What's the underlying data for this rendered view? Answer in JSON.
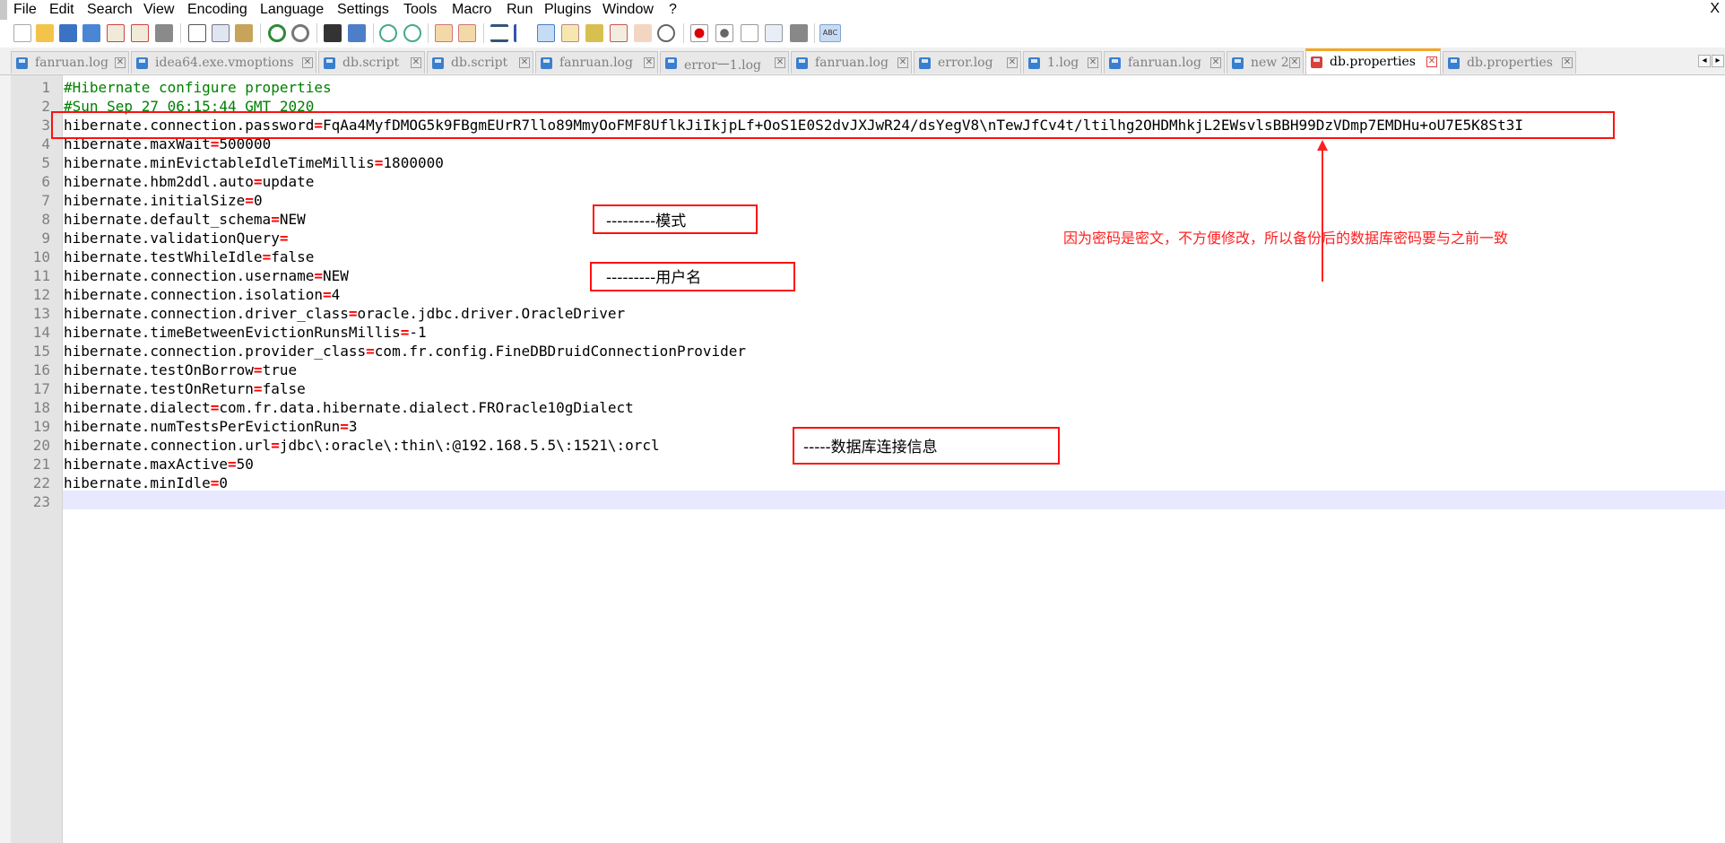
{
  "menu": [
    "File",
    "Edit",
    "Search",
    "View",
    "Encoding",
    "Language",
    "Settings",
    "Tools",
    "Macro",
    "Run",
    "Plugins",
    "Window",
    "?"
  ],
  "window_close": "X",
  "toolbar_icons": [
    "new-file-icon",
    "open-file-icon",
    "save-icon",
    "save-all-icon",
    "close-icon",
    "close-all-icon",
    "print-icon",
    "cut-icon",
    "copy-icon",
    "paste-icon",
    "undo-icon",
    "redo-icon",
    "find-icon",
    "replace-icon",
    "zoom-in-icon",
    "zoom-out-icon",
    "sync-vertical-icon",
    "sync-horizontal-icon",
    "word-wrap-icon",
    "show-all-chars-icon",
    "indent-guide-icon",
    "language-icon",
    "function-list-icon",
    "folder-workspace-icon",
    "monitoring-icon",
    "record-macro-icon",
    "stop-macro-icon",
    "play-macro-icon",
    "run-macro-multiple-icon",
    "save-macro-icon",
    "spell-check-icon"
  ],
  "tabs": [
    {
      "label": "fanruan.log",
      "active": false
    },
    {
      "label": "idea64.exe.vmoptions",
      "active": false
    },
    {
      "label": "db.script",
      "active": false
    },
    {
      "label": "db.script",
      "active": false
    },
    {
      "label": "fanruan.log",
      "active": false
    },
    {
      "label": "error一1.log",
      "active": false
    },
    {
      "label": "fanruan.log",
      "active": false
    },
    {
      "label": "error.log",
      "active": false
    },
    {
      "label": "1.log",
      "active": false
    },
    {
      "label": "fanruan.log",
      "active": false
    },
    {
      "label": "new 2",
      "active": false
    },
    {
      "label": "db.properties",
      "active": true
    },
    {
      "label": "db.properties",
      "active": false
    }
  ],
  "tab_scroll": {
    "left": "◂",
    "right": "▸"
  },
  "lines": [
    {
      "n": "1",
      "comment": "#Hibernate configure properties"
    },
    {
      "n": "2",
      "comment": "#Sun Sep 27 06:15:44 GMT 2020"
    },
    {
      "n": "3",
      "key": "hibernate.connection.password",
      "value": "FqAa4MyfDMOG5k9FBgmEUrR7llo89MmyOoFMF8UflkJiIkjpLf+OoS1E0S2dvJXJwR24/dsYegV8\\nTewJfCv4t/ltilhg2OHDMhkjL2EWsvlsBBH99DzVDmp7EMDHu+oU7E5K8St3I"
    },
    {
      "n": "4",
      "key": "hibernate.maxWait",
      "value": "500000"
    },
    {
      "n": "5",
      "key": "hibernate.minEvictableIdleTimeMillis",
      "value": "1800000"
    },
    {
      "n": "6",
      "key": "hibernate.hbm2ddl.auto",
      "value": "update"
    },
    {
      "n": "7",
      "key": "hibernate.initialSize",
      "value": "0"
    },
    {
      "n": "8",
      "key": "hibernate.default_schema",
      "value": "NEW"
    },
    {
      "n": "9",
      "key": "hibernate.validationQuery",
      "value": ""
    },
    {
      "n": "10",
      "key": "hibernate.testWhileIdle",
      "value": "false"
    },
    {
      "n": "11",
      "key": "hibernate.connection.username",
      "value": "NEW"
    },
    {
      "n": "12",
      "key": "hibernate.connection.isolation",
      "value": "4"
    },
    {
      "n": "13",
      "key": "hibernate.connection.driver_class",
      "value": "oracle.jdbc.driver.OracleDriver"
    },
    {
      "n": "14",
      "key": "hibernate.timeBetweenEvictionRunsMillis",
      "value": "-1"
    },
    {
      "n": "15",
      "key": "hibernate.connection.provider_class",
      "value": "com.fr.config.FineDBDruidConnectionProvider"
    },
    {
      "n": "16",
      "key": "hibernate.testOnBorrow",
      "value": "true"
    },
    {
      "n": "17",
      "key": "hibernate.testOnReturn",
      "value": "false"
    },
    {
      "n": "18",
      "key": "hibernate.dialect",
      "value": "com.fr.data.hibernate.dialect.FROracle10gDialect"
    },
    {
      "n": "19",
      "key": "hibernate.numTestsPerEvictionRun",
      "value": "3"
    },
    {
      "n": "20",
      "key": "hibernate.connection.url",
      "value": "jdbc\\:oracle\\:thin\\:@192.168.5.5\\:1521\\:orcl"
    },
    {
      "n": "21",
      "key": "hibernate.maxActive",
      "value": "50"
    },
    {
      "n": "22",
      "key": "hibernate.minIdle",
      "value": "0"
    },
    {
      "n": "23"
    }
  ],
  "annotations": {
    "schema_note": "---------模式",
    "username_note": "---------用户名",
    "url_note": "-----数据库连接信息",
    "password_note": "因为密码是密文，不方便修改，所以备份后的数据库密码要与之前一致"
  },
  "colors": {
    "annotation": "#ff1010",
    "operator": "#ff0000",
    "comment": "#008000",
    "active_tab_accent": "#f5a623"
  }
}
